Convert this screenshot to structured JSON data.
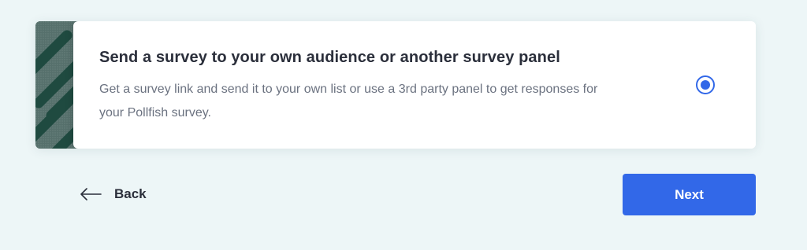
{
  "option": {
    "title": "Send a survey to your own audience or another survey panel",
    "description": "Get a survey link and send it to your own list or use a 3rd party panel to get responses for your Pollfish survey.",
    "selected": true,
    "graphic_icon": "pollfish-logo-stripes"
  },
  "navigation": {
    "back_label": "Back",
    "back_icon": "arrow-left-icon",
    "next_label": "Next"
  },
  "colors": {
    "page_background": "#edf6f7",
    "accent": "#3268e8",
    "graphic_background": "#56706c",
    "graphic_stripe": "#1f4a40",
    "title_text": "#2b2f3b",
    "body_text": "#6b7280"
  }
}
